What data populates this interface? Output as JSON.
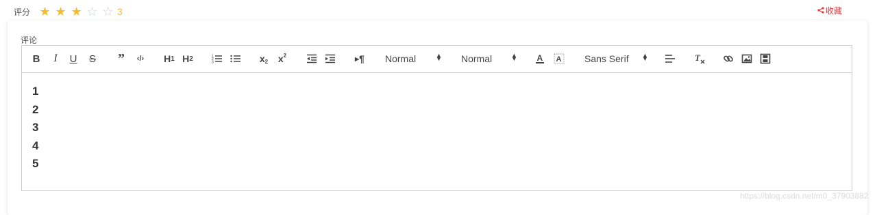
{
  "rating": {
    "label": "评分",
    "score": "3",
    "stars": [
      {
        "state": "filled"
      },
      {
        "state": "filled"
      },
      {
        "state": "filled"
      },
      {
        "state": "empty"
      },
      {
        "state": "empty"
      }
    ],
    "filled_color": "#f7ba2a",
    "empty_color": "#c6d1de"
  },
  "favorite": {
    "label": "收藏",
    "color": "#e4393c",
    "icon": "share-icon"
  },
  "comment": {
    "label": "评论"
  },
  "toolbar": {
    "buttons": [
      "bold-icon",
      "italic-icon",
      "underline-icon",
      "strike-icon",
      "blockquote-icon",
      "code-block-icon",
      "header-1-icon",
      "header-2-icon",
      "ordered-list-icon",
      "bullet-list-icon",
      "subscript-icon",
      "superscript-icon",
      "outdent-icon",
      "indent-icon",
      "rtl-direction-icon"
    ],
    "size_picker": "Normal",
    "header_picker": "Normal",
    "font_picker": "Sans Serif",
    "buttons_after": [
      "text-color-icon",
      "background-color-icon",
      "align-icon",
      "clean-format-icon",
      "link-icon",
      "image-icon",
      "video-icon"
    ]
  },
  "editor": {
    "lines": [
      "1",
      "2",
      "3",
      "4",
      "5"
    ]
  },
  "watermark": "https://blog.csdn.net/m0_37903882"
}
